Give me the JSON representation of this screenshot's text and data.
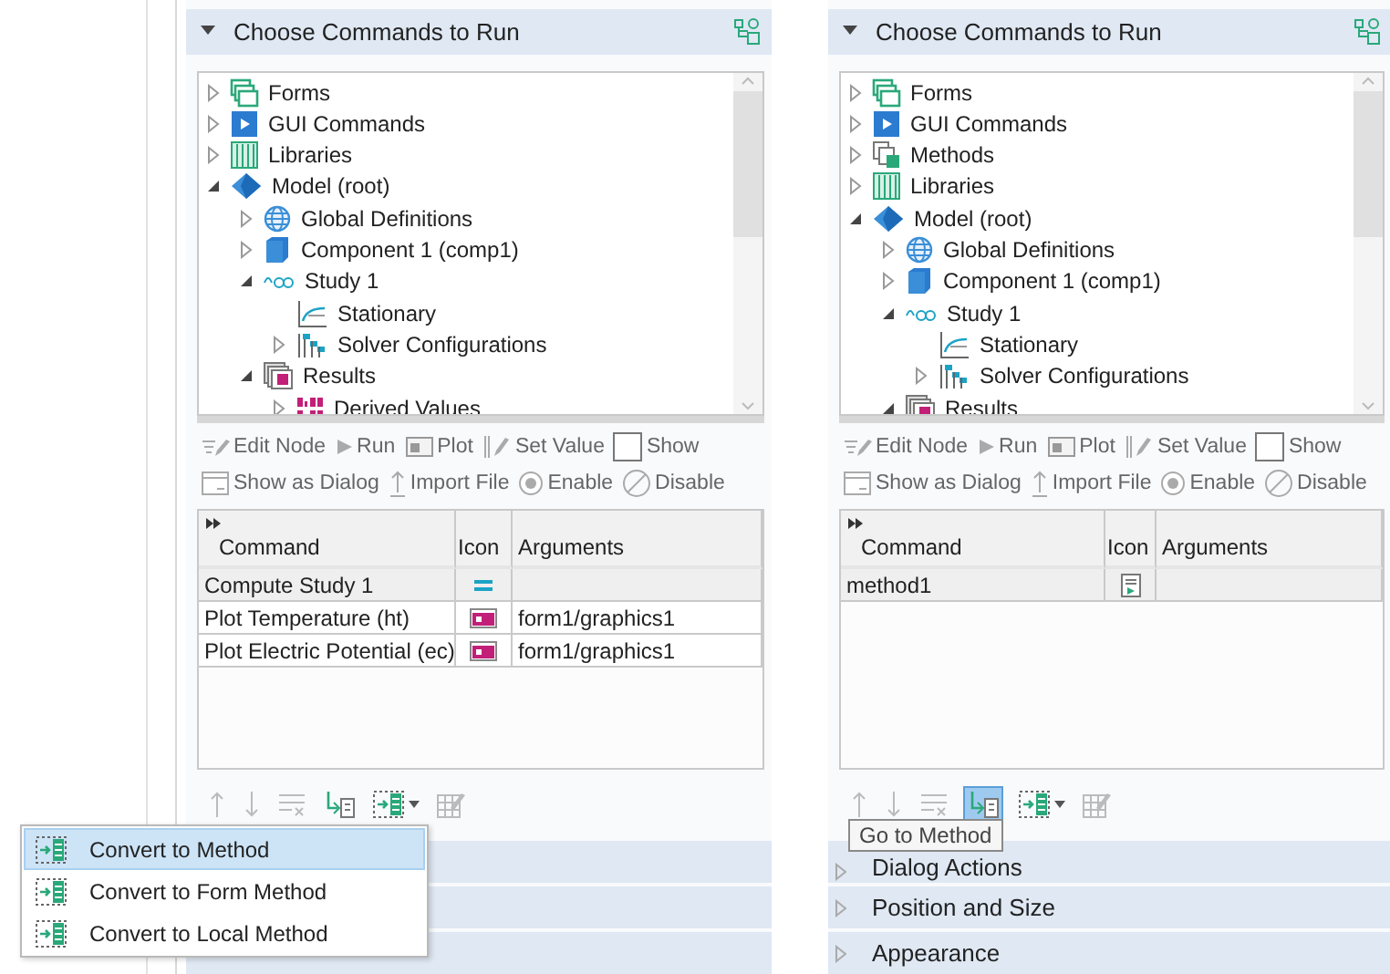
{
  "panels": [
    {
      "header": {
        "title": "Choose Commands to Run",
        "expanded": true
      },
      "tree": [
        {
          "label": "Forms",
          "kind": "forms",
          "expanded": false
        },
        {
          "label": "GUI Commands",
          "kind": "gui",
          "expanded": false
        },
        {
          "label": "Libraries",
          "kind": "libraries",
          "expanded": false
        },
        {
          "label": "Model (root)",
          "kind": "model",
          "expanded": true,
          "children": [
            {
              "label": "Global Definitions",
              "kind": "globe",
              "expanded": false
            },
            {
              "label": "Component 1 (comp1)",
              "kind": "component",
              "expanded": false
            },
            {
              "label": "Study 1",
              "kind": "study",
              "expanded": true,
              "children": [
                {
                  "label": "Stationary",
                  "kind": "stationary"
                },
                {
                  "label": "Solver Configurations",
                  "kind": "solver",
                  "expanded": false
                }
              ]
            },
            {
              "label": "Results",
              "kind": "results",
              "expanded": true,
              "children": [
                {
                  "label": "Derived Values",
                  "kind": "derived",
                  "expanded": false
                }
              ]
            }
          ]
        }
      ],
      "toolbar": [
        [
          {
            "label": "Edit Node",
            "kind": "edit",
            "disabled": true
          },
          {
            "label": "Run",
            "kind": "run",
            "disabled": true
          },
          {
            "label": "Plot",
            "kind": "plot",
            "disabled": true
          },
          {
            "label": "Set Value",
            "kind": "setvalue",
            "disabled": true
          },
          {
            "label": "Show",
            "kind": "show",
            "disabled": true
          }
        ],
        [
          {
            "label": "Show as Dialog",
            "kind": "dialog",
            "disabled": true
          },
          {
            "label": "Import File",
            "kind": "import",
            "disabled": true
          },
          {
            "label": "Enable",
            "kind": "enable",
            "disabled": true
          },
          {
            "label": "Disable",
            "kind": "disable",
            "disabled": true
          }
        ]
      ],
      "table": {
        "columns": [
          "Command",
          "Icon",
          "Arguments"
        ],
        "rows": [
          {
            "command": "Compute Study 1",
            "kind": "compute",
            "selected": true
          },
          {
            "command": "Plot Temperature (ht)",
            "kind": "plot",
            "arguments": "form1/graphics1",
            "selected": false
          },
          {
            "command": "Plot Electric Potential (ec)",
            "kind": "plot",
            "arguments": "form1/graphics1",
            "selected": false
          }
        ]
      },
      "bottom_toolbar": [
        {
          "kind": "up",
          "highlighted": false
        },
        {
          "kind": "down",
          "highlighted": false
        },
        {
          "kind": "delete",
          "highlighted": false
        },
        {
          "kind": "goto",
          "highlighted": false
        },
        {
          "kind": "convert",
          "highlighted": false
        },
        {
          "kind": "edit",
          "highlighted": false
        }
      ],
      "sections": [
        {
          "kind": "covered"
        },
        {
          "kind": "covered"
        },
        {
          "kind": "covered"
        }
      ],
      "menu": [
        {
          "label": "Convert to Method",
          "selected": true
        },
        {
          "label": "Convert to Form Method",
          "selected": false
        },
        {
          "label": "Convert to Local Method",
          "selected": false
        }
      ]
    },
    {
      "header": {
        "title": "Choose Commands to Run",
        "expanded": true
      },
      "tree": [
        {
          "label": "Forms",
          "kind": "forms",
          "expanded": false
        },
        {
          "label": "GUI Commands",
          "kind": "gui",
          "expanded": false
        },
        {
          "label": "Methods",
          "kind": "methods",
          "expanded": false
        },
        {
          "label": "Libraries",
          "kind": "libraries",
          "expanded": false
        },
        {
          "label": "Model (root)",
          "kind": "model",
          "expanded": true,
          "children": [
            {
              "label": "Global Definitions",
              "kind": "globe",
              "expanded": false
            },
            {
              "label": "Component 1 (comp1)",
              "kind": "component",
              "expanded": false
            },
            {
              "label": "Study 1",
              "kind": "study",
              "expanded": true,
              "children": [
                {
                  "label": "Stationary",
                  "kind": "stationary"
                },
                {
                  "label": "Solver Configurations",
                  "kind": "solver",
                  "expanded": false
                }
              ]
            },
            {
              "label": "Results",
              "kind": "results",
              "expanded": true
            }
          ]
        }
      ],
      "toolbar": [
        [
          {
            "label": "Edit Node",
            "kind": "edit",
            "disabled": true
          },
          {
            "label": "Run",
            "kind": "run",
            "disabled": true
          },
          {
            "label": "Plot",
            "kind": "plot",
            "disabled": true
          },
          {
            "label": "Set Value",
            "kind": "setvalue",
            "disabled": true
          },
          {
            "label": "Show",
            "kind": "show",
            "disabled": true
          }
        ],
        [
          {
            "label": "Show as Dialog",
            "kind": "dialog",
            "disabled": true
          },
          {
            "label": "Import File",
            "kind": "import",
            "disabled": true
          },
          {
            "label": "Enable",
            "kind": "enable",
            "disabled": true
          },
          {
            "label": "Disable",
            "kind": "disable",
            "disabled": true
          }
        ]
      ],
      "table": {
        "columns": [
          "Command",
          "Icon",
          "Arguments"
        ],
        "rows": [
          {
            "command": "method1",
            "kind": "method",
            "selected": true
          }
        ]
      },
      "bottom_toolbar": [
        {
          "kind": "up",
          "highlighted": false
        },
        {
          "kind": "down",
          "highlighted": false
        },
        {
          "kind": "delete",
          "highlighted": false
        },
        {
          "kind": "goto",
          "highlighted": true
        },
        {
          "kind": "convert",
          "highlighted": false
        },
        {
          "kind": "edit",
          "highlighted": false
        }
      ],
      "sections": [
        {
          "kind": "section",
          "title": "Dialog Actions",
          "expanded": false
        },
        {
          "kind": "section",
          "title": "Position and Size",
          "expanded": false
        },
        {
          "kind": "section",
          "title": "Appearance",
          "expanded": false
        }
      ],
      "tooltip": "Go to Method"
    }
  ]
}
